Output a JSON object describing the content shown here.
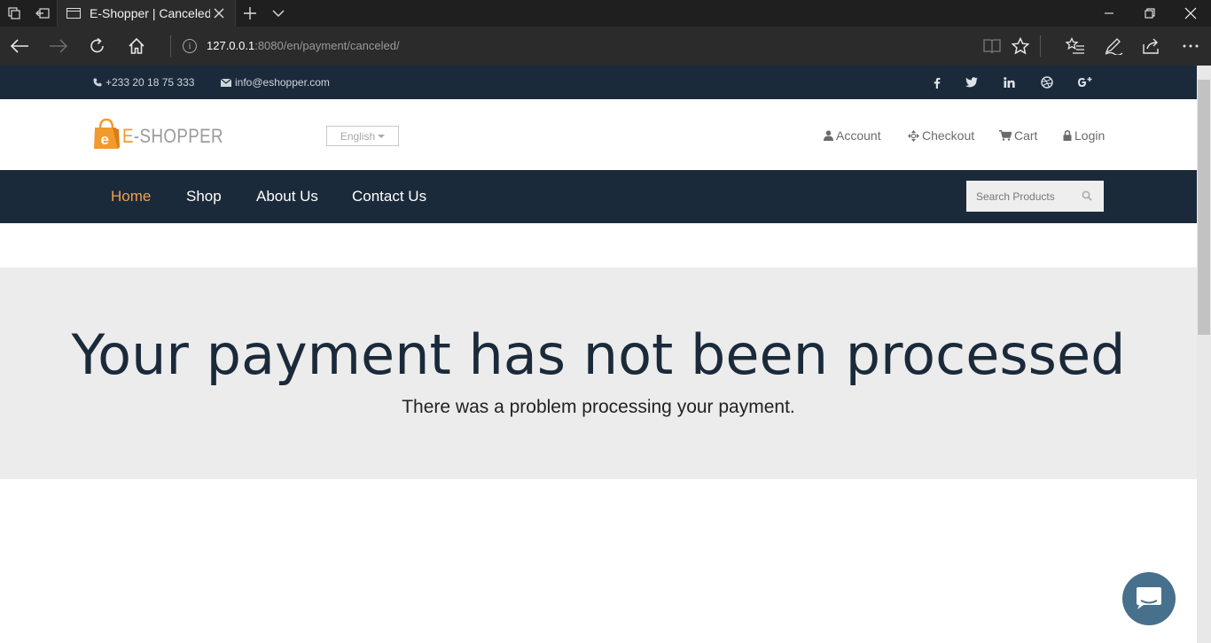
{
  "browser": {
    "tab_title": "E-Shopper | Canceled Pa",
    "url_host": "127.0.0.1",
    "url_rest": ":8080/en/payment/canceled/"
  },
  "topbar": {
    "phone": "+233 20 18 75 333",
    "email": "info@eshopper.com",
    "social_icons": [
      "facebook-icon",
      "twitter-icon",
      "linkedin-icon",
      "dribbble-icon",
      "google-plus-icon"
    ]
  },
  "header": {
    "logo_e": "E",
    "logo_rest": "-SHOPPER",
    "language": "English",
    "links": {
      "account": "Account",
      "checkout": "Checkout",
      "cart": "Cart",
      "login": "Login"
    }
  },
  "nav": {
    "home": "Home",
    "shop": "Shop",
    "about": "About Us",
    "contact": "Contact Us",
    "search_placeholder": "Search Products"
  },
  "hero": {
    "title": "Your payment has not been processed",
    "subtitle": "There was a problem processing your payment."
  },
  "colors": {
    "navy": "#1b2a3a",
    "accent": "#f0a04b",
    "hero_bg": "#ececec",
    "chat": "#47708d"
  }
}
